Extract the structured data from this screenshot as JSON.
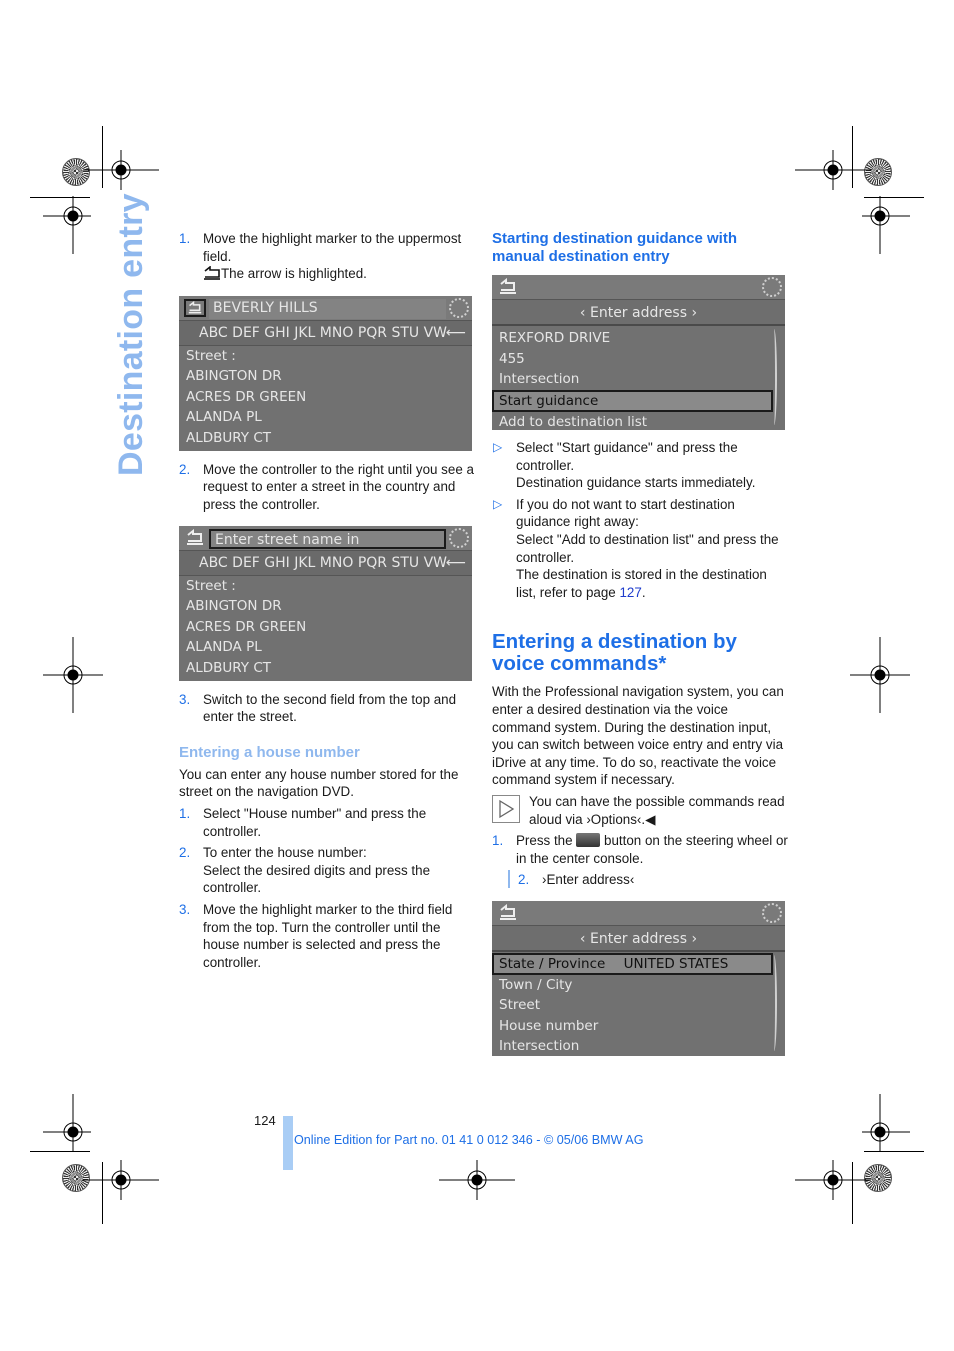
{
  "side_title": "Destination entry",
  "left": {
    "step1": {
      "num": "1.",
      "text": "Move the highlight marker to the uppermost field.",
      "note": "The arrow is highlighted."
    },
    "screen1": {
      "field": "BEVERLY HILLS",
      "alphabet": "ABC DEF GHI JKL MNO PQR STU VW",
      "label": "Street :",
      "items": [
        "ABINGTON DR",
        "ACRES DR GREEN",
        "ALANDA PL",
        "ALDBURY CT"
      ]
    },
    "step2": {
      "num": "2.",
      "text": "Move the controller to the right until you see a request to enter a street in the country and press the controller."
    },
    "screen2": {
      "field": "Enter street name in CALIFORNIA?",
      "alphabet": "ABC DEF GHI JKL MNO PQR STU VW",
      "label": "Street :",
      "items": [
        "ABINGTON DR",
        "ACRES DR GREEN",
        "ALANDA PL",
        "ALDBURY CT"
      ]
    },
    "step3": {
      "num": "3.",
      "text": "Switch to the second field from the top and enter the street."
    },
    "house_heading": "Entering a house number",
    "house_intro": "You can enter any house number stored for the street on the navigation DVD.",
    "house_steps": [
      {
        "num": "1.",
        "text": "Select \"House number\" and press the controller."
      },
      {
        "num": "2.",
        "text": "To enter the house number:",
        "text2": "Select the desired digits and press the controller."
      },
      {
        "num": "3.",
        "text": "Move the highlight marker to the third field from the top. Turn the controller until the house number is selected and press the controller."
      }
    ]
  },
  "right": {
    "heading": "Starting destination guidance with manual destination entry",
    "screen3": {
      "title": "Enter address",
      "items": [
        "REXFORD DRIVE",
        "455",
        "Intersection",
        "Start guidance",
        "Add to destination list"
      ],
      "selected_index": 3
    },
    "bullets": [
      {
        "text": "Select \"Start guidance\" and press the controller.",
        "text2": "Destination guidance starts immediately."
      },
      {
        "text": "If you do not want to start destination guidance right away:",
        "text2": "Select \"Add to destination list\" and press the controller.",
        "text3": "The destination is stored in the destination list, refer to page ",
        "link": "127",
        "tail": "."
      }
    ],
    "voice_heading": "Entering a destination by voice commands*",
    "voice_intro": "With the Professional navigation system, you can enter a desired destination via the voice command system. During the destination input, you can switch between voice entry and entry via iDrive at any time. To do so, reactivate the voice command system if necessary.",
    "note": "You can have the possible commands read aloud via ›Options‹.◀",
    "voice_steps": [
      {
        "num": "1.",
        "pre": "Press the ",
        "post": " button on the steering wheel or in the center console."
      },
      {
        "num": "2.",
        "text": "›Enter address‹"
      }
    ],
    "screen4": {
      "title": "Enter address",
      "items": [
        {
          "label": "State / Province",
          "value": "UNITED STATES"
        },
        {
          "label": "Town / City",
          "value": ""
        },
        {
          "label": "Street",
          "value": ""
        },
        {
          "label": "House number",
          "value": ""
        },
        {
          "label": "Intersection",
          "value": ""
        }
      ],
      "selected_index": 0
    }
  },
  "footer": {
    "page_number": "124",
    "text": "Online Edition for Part no. 01 41 0 012 346 - © 05/06 BMW AG"
  }
}
